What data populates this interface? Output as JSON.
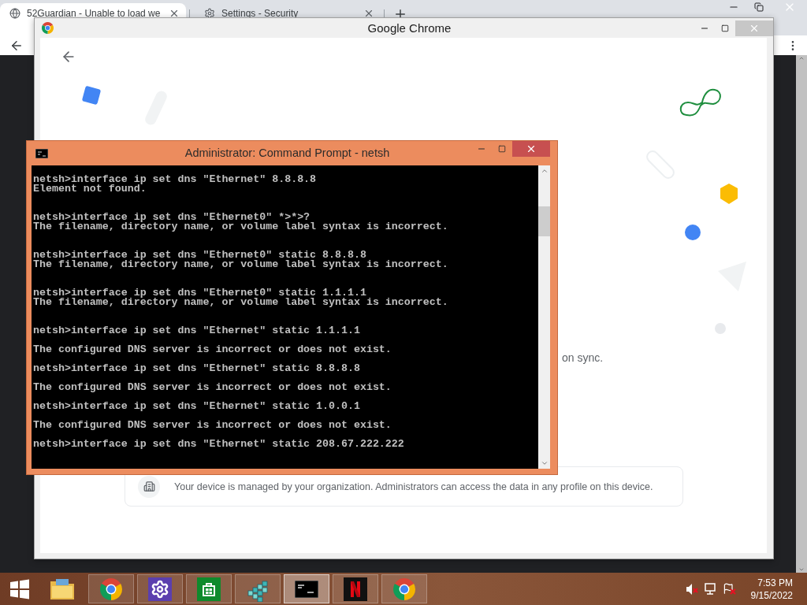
{
  "browser": {
    "tabs": [
      {
        "title": "52Guardian - Unable to load we",
        "selected": true
      },
      {
        "title": "Settings - Security",
        "selected": false
      }
    ]
  },
  "dialog": {
    "title": "Google Chrome",
    "sync_text": "on sync.",
    "managed_notice": "Your device is managed by your organization. Administrators can access the data in any profile on this device."
  },
  "console_window": {
    "title": "Administrator: Command Prompt - netsh",
    "blocks": [
      {
        "kind": "tight",
        "command": "netsh>interface ip set dns \"Ethernet\" 8.8.8.8",
        "output": "Element not found."
      },
      {
        "kind": "tight",
        "command": "netsh>interface ip set dns \"Ethernet0\" *>*>?",
        "output": "The filename, directory name, or volume label syntax is incorrect."
      },
      {
        "kind": "tight",
        "command": "netsh>interface ip set dns \"Ethernet0\" static 8.8.8.8",
        "output": "The filename, directory name, or volume label syntax is incorrect."
      },
      {
        "kind": "tight",
        "command": "netsh>interface ip set dns \"Ethernet0\" static 1.1.1.1",
        "output": "The filename, directory name, or volume label syntax is incorrect."
      },
      {
        "kind": "spaced",
        "command": "netsh>interface ip set dns \"Ethernet\" static 1.1.1.1",
        "output": "The configured DNS server is incorrect or does not exist."
      },
      {
        "kind": "spaced",
        "command": "netsh>interface ip set dns \"Ethernet\" static 8.8.8.8",
        "output": "The configured DNS server is incorrect or does not exist."
      },
      {
        "kind": "spaced",
        "command": "netsh>interface ip set dns \"Ethernet\" static 1.0.0.1",
        "output": "The configured DNS server is incorrect or does not exist."
      },
      {
        "kind": "spaced",
        "command": "netsh>interface ip set dns \"Ethernet\" static 208.67.222.222"
      }
    ]
  },
  "taskbar": {
    "apps": [
      {
        "kind": "explorer",
        "running": false,
        "active": false
      },
      {
        "kind": "chrome",
        "running": true,
        "active": false
      },
      {
        "kind": "settings",
        "running": true,
        "active": false
      },
      {
        "kind": "store",
        "running": true,
        "active": false
      },
      {
        "kind": "cubes",
        "running": true,
        "active": false
      },
      {
        "kind": "console",
        "running": true,
        "active": true
      },
      {
        "kind": "netflix",
        "running": true,
        "active": false
      },
      {
        "kind": "chrome",
        "running": true,
        "active": false
      }
    ],
    "time": "7:53 PM",
    "date": "9/15/2022"
  }
}
